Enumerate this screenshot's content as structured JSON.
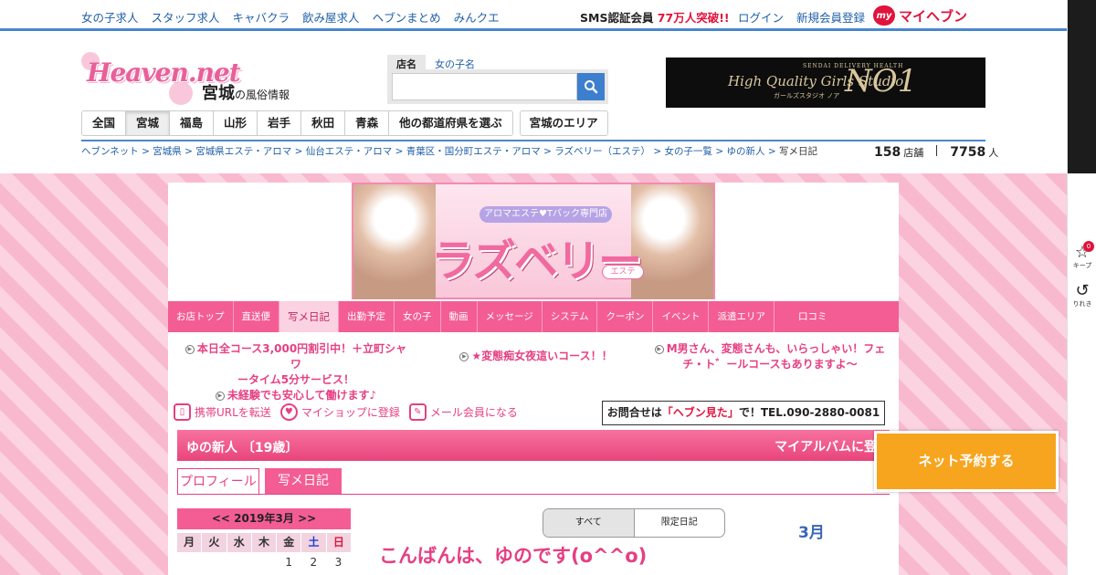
{
  "topnav": {
    "links": [
      "女の子求人",
      "スタッフ求人",
      "キャバクラ",
      "飲み屋求人",
      "ヘブンまとめ",
      "みんクエ"
    ],
    "sms_prefix": "SMS認証会員 ",
    "sms_highlight": "77万人突破!!",
    "login": "ログイン",
    "register": "新規会員登録",
    "my_badge": "my",
    "my_heaven": "マイヘブン"
  },
  "sidebar_tools": {
    "keep_label": "キープ",
    "keep_count": "0",
    "history_label": "りれき"
  },
  "header": {
    "logo_text": "Heaven.net",
    "region": "宮城",
    "region_suffix": "の風俗情報"
  },
  "search": {
    "tab_shop": "店名",
    "tab_girl": "女の子名",
    "placeholder": ""
  },
  "ad_banner": {
    "small": "SENDAI DELIVERY HEALTH",
    "main": "High Quality Girls Studio",
    "big": "NO1",
    "jp": "ガールズスタジオ ノア"
  },
  "prefnav": {
    "items": [
      "全国",
      "宮城",
      "福島",
      "山形",
      "岩手",
      "秋田",
      "青森",
      "他の都道府県を選ぶ"
    ],
    "area": "宮城のエリア"
  },
  "breadcrumbs": [
    "ヘブンネット",
    "宮城県",
    "宮城県エステ・アロマ",
    "仙台エステ・アロマ",
    "青葉区・国分町エステ・アロマ",
    "ラズベリー（エステ）",
    "女の子一覧",
    "ゆの新人"
  ],
  "breadcrumb_current": "写メ日記",
  "counts": {
    "shops": "158",
    "shops_unit": "店舗",
    "people": "7758",
    "people_unit": "人"
  },
  "shop_banner": {
    "ribbon": "アロマエステ♥Tバック専門店",
    "name": "ラズベリー",
    "sub": "エステ"
  },
  "shopnav": [
    "お店トップ",
    "直送便",
    "写メ日記",
    "出勤予定",
    "女の子",
    "動画",
    "メッセージ",
    "システム",
    "クーポン",
    "イベント",
    "派遣エリア",
    "口コミ"
  ],
  "promos": {
    "p1_line1": "本日全コース3,000円割引中！＋立町シャワ",
    "p1_line2": "ータイム5分サービス！",
    "p1_line3": "未経験でも安心して働けます♪",
    "p2": "★変態痴女夜這いコース！！",
    "p3_line1": "M男さん、変態さんも、いらっしゃい！フェ",
    "p3_line2": "チ・ト゛ールコースもありますよ～"
  },
  "actions": {
    "mobile": "携帯URLを転送",
    "myshop": "マイショップに登録",
    "member": "メール会員になる"
  },
  "inquiry": {
    "prefix": "お問合せは",
    "highlight": "「ヘブン見た」",
    "suffix": "で！TEL.090-2880-0081"
  },
  "girl": {
    "name": "ゆの新人 〔19歳〕",
    "album": "マイアルバムに登録"
  },
  "girl_tabs": {
    "profile": "プロフィール",
    "diary": "写メ日記"
  },
  "calendar": {
    "prev": "<<",
    "title": "2019年3月",
    "next": ">>",
    "weekdays": [
      "月",
      "火",
      "水",
      "木",
      "金",
      "土",
      "日"
    ],
    "first_row": [
      "",
      "",
      "",
      "",
      "1",
      "2",
      "3"
    ]
  },
  "diary_filter": {
    "all": "すべて",
    "limited": "限定日記"
  },
  "month_label": "3月",
  "post_title": "こんばんは、ゆのです(o^^o)",
  "reserve_button": "ネット予約する",
  "colors": {
    "accent_pink": "#f35d93",
    "link_blue": "#1f5fa8",
    "alert_red": "#e0143c",
    "reserve_orange": "#f7a51f"
  }
}
